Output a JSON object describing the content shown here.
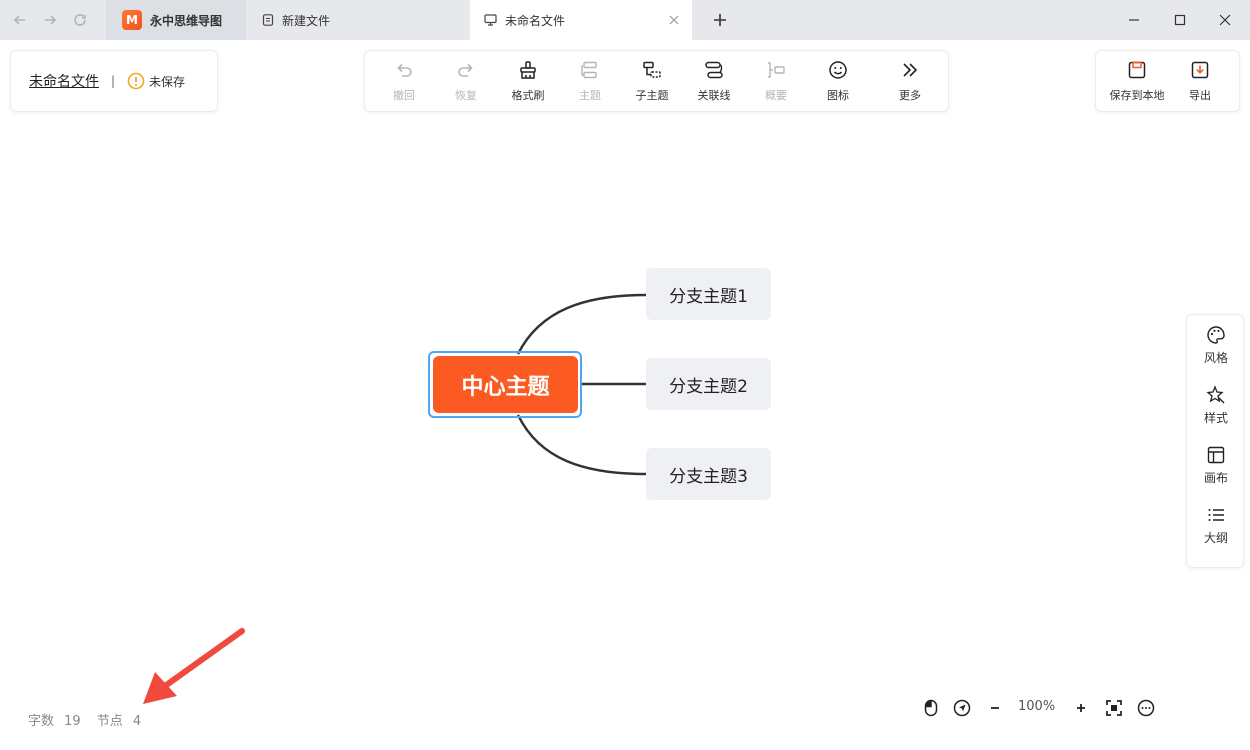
{
  "titlebar": {
    "app_tab": "永中思维导图",
    "app_logo_letter": "M",
    "tabs": [
      {
        "label": "新建文件",
        "icon": "document-icon"
      },
      {
        "label": "未命名文件",
        "icon": "monitor-icon"
      }
    ]
  },
  "document": {
    "name": "未命名文件",
    "separator": "|",
    "status": "未保存"
  },
  "toolbar": {
    "items": [
      {
        "label": "撤回",
        "icon": "undo-icon",
        "enabled": false
      },
      {
        "label": "恢复",
        "icon": "redo-icon",
        "enabled": false
      },
      {
        "label": "格式刷",
        "icon": "format-brush-icon",
        "enabled": true
      },
      {
        "label": "主题",
        "icon": "topic-icon",
        "enabled": false
      },
      {
        "label": "子主题",
        "icon": "subtopic-icon",
        "enabled": true
      },
      {
        "label": "关联线",
        "icon": "relation-line-icon",
        "enabled": true
      },
      {
        "label": "概要",
        "icon": "summary-icon",
        "enabled": false
      },
      {
        "label": "图标",
        "icon": "emoji-icon",
        "enabled": true
      },
      {
        "label": "更多",
        "icon": "double-chevron-icon",
        "enabled": true
      }
    ]
  },
  "savebar": {
    "save_local": "保存到本地",
    "export": "导出"
  },
  "sidepanel": {
    "items": [
      {
        "label": "风格",
        "icon": "palette-icon"
      },
      {
        "label": "样式",
        "icon": "star-pen-icon"
      },
      {
        "label": "画布",
        "icon": "canvas-layout-icon"
      },
      {
        "label": "大纲",
        "icon": "list-icon"
      }
    ]
  },
  "mindmap": {
    "central": "中心主题",
    "branches": [
      "分支主题1",
      "分支主题2",
      "分支主题3"
    ]
  },
  "status": {
    "word_count_label": "字数",
    "word_count": "19",
    "node_count_label": "节点",
    "node_count": "4"
  },
  "zoom": {
    "value": "100%"
  },
  "colors": {
    "central_node": "#fb5a23",
    "selection": "#4ea6f5",
    "branch_bg": "#eef0f3",
    "annotation_arrow": "#f04a3e"
  }
}
